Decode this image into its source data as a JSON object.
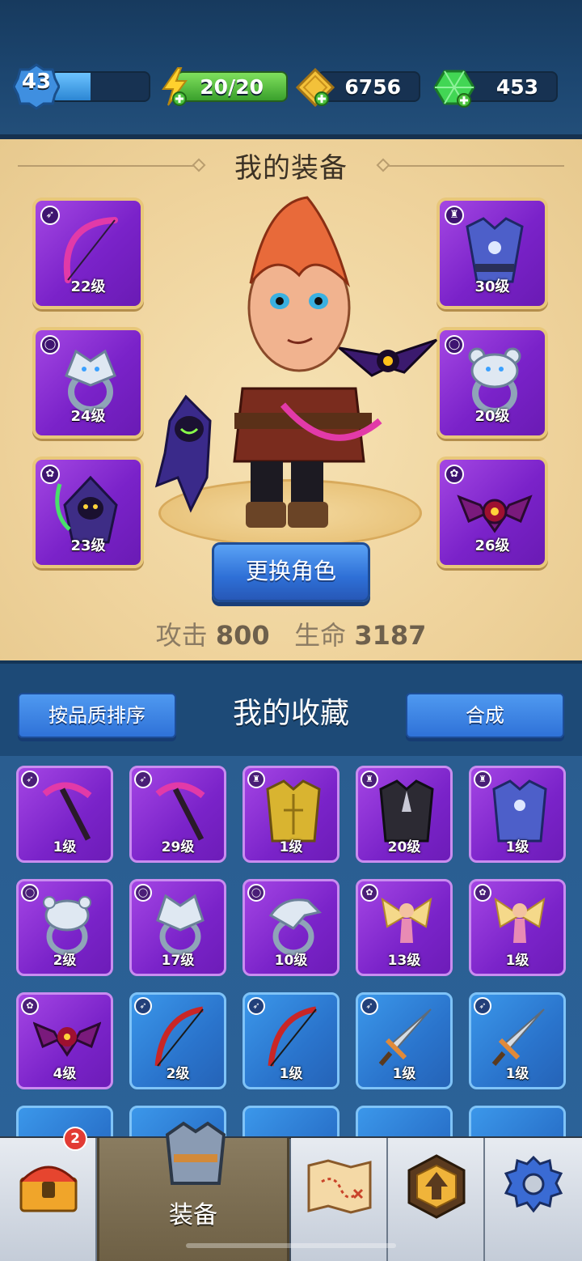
{
  "status": {
    "level": "43",
    "level_progress": 0.4,
    "energy": "20/20",
    "gold": "6756",
    "gems": "453"
  },
  "equipment": {
    "title": "我的装备",
    "slots": [
      {
        "type": "bow",
        "level": "22级",
        "icon": "bow-icon"
      },
      {
        "type": "armor",
        "level": "30级",
        "icon": "armor-icon"
      },
      {
        "type": "ring",
        "level": "24级",
        "icon": "ring-icon"
      },
      {
        "type": "ring",
        "level": "20级",
        "icon": "ring-icon"
      },
      {
        "type": "pet",
        "level": "23级",
        "icon": "pet-icon"
      },
      {
        "type": "pet",
        "level": "26级",
        "icon": "pet-icon"
      }
    ],
    "change_character": "更换角色",
    "attack_label": "攻击",
    "attack_value": "800",
    "hp_label": "生命",
    "hp_value": "3187"
  },
  "collection": {
    "sort_button": "按品质排序",
    "title": "我的收藏",
    "merge_button": "合成",
    "items": [
      {
        "level": "1级",
        "rarity": "epic",
        "kind": "scythe"
      },
      {
        "level": "29级",
        "rarity": "epic",
        "kind": "scythe"
      },
      {
        "level": "1级",
        "rarity": "epic",
        "kind": "armor-gold"
      },
      {
        "level": "20级",
        "rarity": "epic",
        "kind": "armor-dark"
      },
      {
        "level": "1级",
        "rarity": "epic",
        "kind": "armor-blue"
      },
      {
        "level": "2级",
        "rarity": "epic",
        "kind": "ring-bear"
      },
      {
        "level": "17级",
        "rarity": "epic",
        "kind": "ring-wolf"
      },
      {
        "level": "10级",
        "rarity": "epic",
        "kind": "ring-eagle"
      },
      {
        "level": "13级",
        "rarity": "epic",
        "kind": "fairy"
      },
      {
        "level": "1级",
        "rarity": "epic",
        "kind": "fairy"
      },
      {
        "level": "4级",
        "rarity": "epic",
        "kind": "bat"
      },
      {
        "level": "2级",
        "rarity": "rare",
        "kind": "bow-red"
      },
      {
        "level": "1级",
        "rarity": "rare",
        "kind": "bow-red"
      },
      {
        "level": "1级",
        "rarity": "rare",
        "kind": "sword"
      },
      {
        "level": "1级",
        "rarity": "rare",
        "kind": "sword"
      }
    ]
  },
  "nav": {
    "chest_badge": "2",
    "active_label": "装备"
  }
}
